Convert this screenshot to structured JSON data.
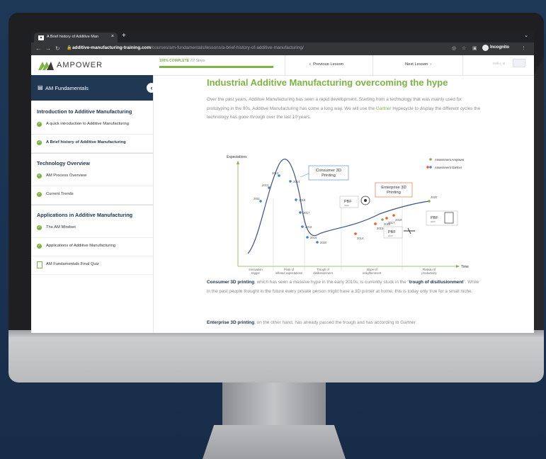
{
  "browser": {
    "tab_title": "A Brief history of Additive Man",
    "url_domain": "additive-manufacturing-training.com",
    "url_path": "/courses/am-fundamentals/lessons/a-brief-history-of-additive-manufacturing/",
    "incognito_label": "Incognito"
  },
  "header": {
    "logo_text": "AMPOWER",
    "progress_label": "100% COMPLETE",
    "progress_steps": "7/7 Steps",
    "progress_fraction": 1.0,
    "prev_lesson": "Previous Lesson",
    "next_lesson": "Next Lesson",
    "hello_text": "Hello, st"
  },
  "sidebar": {
    "course_title": "AM Fundamentals",
    "sections": [
      {
        "title": "Introduction to Additive Manufacturing",
        "items": [
          {
            "label": "A quick introduction to Additive Manufacturing",
            "active": false
          },
          {
            "label": "A Brief history of Additive Manufacturing",
            "active": true
          }
        ]
      },
      {
        "title": "Technology Overview",
        "items": [
          {
            "label": "AM Process Overview",
            "active": false
          },
          {
            "label": "Current Trends",
            "active": false
          }
        ]
      },
      {
        "title": "Applications in Additive Manufacturing",
        "items": [
          {
            "label": "The AM Mindset",
            "active": false
          },
          {
            "label": "Applications of Additive Manufacturing",
            "active": false
          },
          {
            "label": "AM Fundamentals Final Quiz",
            "active": false
          }
        ]
      }
    ]
  },
  "content": {
    "title": "Industrial Additive Manufacturing overcoming the hype",
    "intro_pre": "Over the past years, Additive Manufacturing has seen a rapid development. Starting from a technology that was mainly used for prototyping in the 90s, Additive Manufacturing has come a long way. We will use the ",
    "intro_link": "Gartner",
    "intro_post": " Hypecycle to display the different cycles the technology has gone through over the last 10 years.",
    "p2_bold": "Consumer 3D printing",
    "p2_mid": ", which has seen a massive hype in the early 2010s, is currently stuck in the \"",
    "p2_bold2": "trough of disillusionment",
    "p2_post": "\". While in the past people thought in the future every private person might have a 3D printer at home, this is today only true for a small niche.",
    "p3_bold": "Enterprise 3D printing",
    "p3_post": ", on the other hand, has already passed the trough and has according to Gartner"
  },
  "chart_data": {
    "type": "line",
    "title": "",
    "ylabel": "Expectations",
    "xlabel": "Time",
    "legend": [
      {
        "name": "Assessment Ampower",
        "color": "#7cb342"
      },
      {
        "name": "Assessment Gartner",
        "color": "#ef5a2a"
      }
    ],
    "phases": [
      "Innovation trigger",
      "Peak of inflated expectations",
      "Trough of disillusionment",
      "Slope of enlightenment",
      "Plateau of productivity"
    ],
    "consumer_label": "Consumer 3D Printing",
    "enterprise_label": "Enterprise 3D Printing",
    "consumer_years": [
      "2011",
      "2012",
      "2013",
      "2014",
      "2016",
      "2017",
      "2018",
      "2019",
      "2020"
    ],
    "enterprise_years": [
      "2014",
      "2015",
      "2016",
      "2017",
      "2019",
      "2020"
    ],
    "badge_pbf": "PBF",
    "badge_2020": "2020",
    "colors": {
      "curve": "#3b4f8c",
      "consumer": "#4a7fd4",
      "gartner": "#ef5a2a",
      "ampower": "#7cb342"
    }
  }
}
